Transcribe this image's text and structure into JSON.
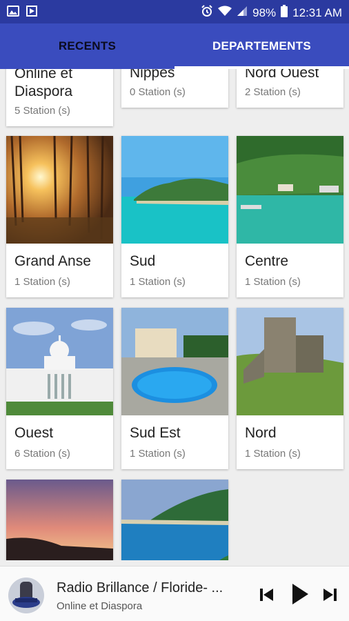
{
  "status_bar": {
    "battery": "98%",
    "time": "12:31 AM",
    "icons": [
      "image-icon",
      "play-store-icon",
      "alarm-icon",
      "wifi-icon",
      "signal-icon",
      "battery-icon"
    ]
  },
  "tabs": [
    {
      "label": "RECENTS"
    },
    {
      "label": "DEPARTEMENTS"
    }
  ],
  "departments": [
    {
      "name": "Online et Diaspora",
      "count": "5 Station (s)"
    },
    {
      "name": "Nippes",
      "count": "0 Station (s)"
    },
    {
      "name": "Nord Ouest",
      "count": "2 Station (s)"
    },
    {
      "name": "Grand Anse",
      "count": "1 Station (s)"
    },
    {
      "name": "Sud",
      "count": "1 Station (s)"
    },
    {
      "name": "Centre",
      "count": "1 Station (s)"
    },
    {
      "name": "Ouest",
      "count": "6 Station (s)"
    },
    {
      "name": "Sud Est",
      "count": "1 Station (s)"
    },
    {
      "name": "Nord",
      "count": "1 Station (s)"
    }
  ],
  "player": {
    "title": "Radio Brillance / Floride- ...",
    "subtitle": "Online et Diaspora",
    "controls": [
      "skip-previous-icon",
      "play-icon",
      "skip-next-icon"
    ]
  },
  "colors": {
    "status_bar": "#2b3aa0",
    "app_bar": "#3a4cbe",
    "tab_active_text": "#ffffff",
    "tab_inactive_text": "#0b0b1e",
    "background": "#eeeeee"
  }
}
